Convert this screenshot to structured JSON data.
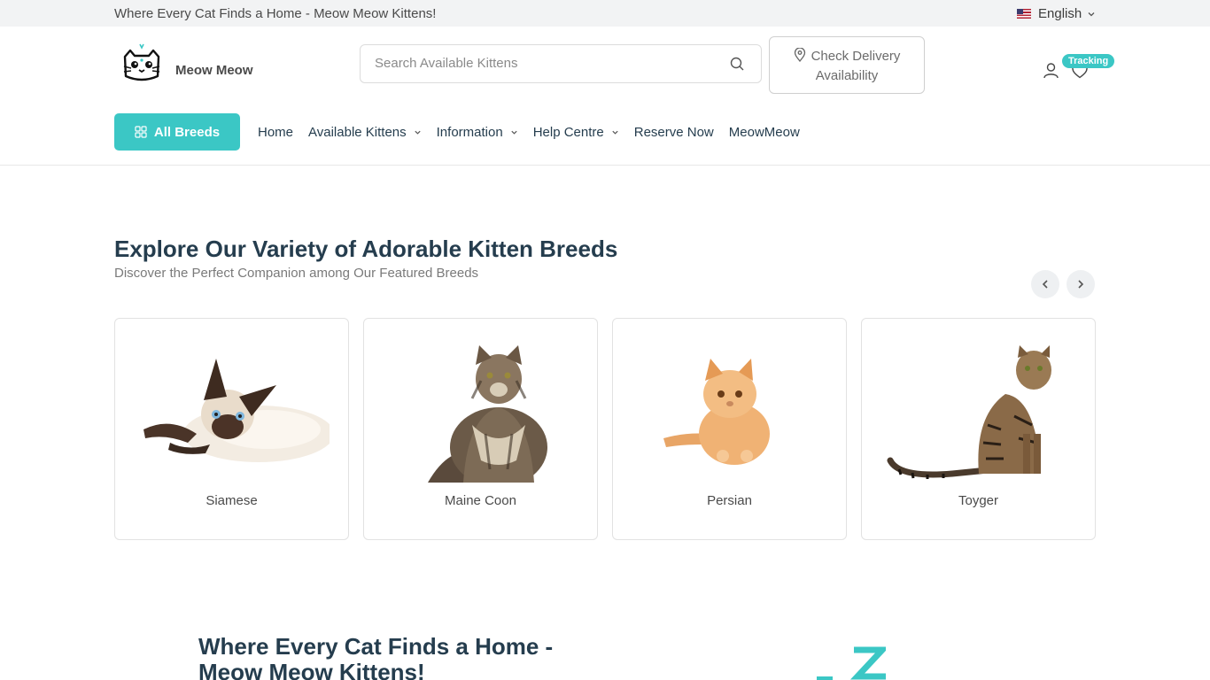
{
  "topbar": {
    "tagline": "Where Every Cat Finds a Home - Meow Meow Kittens!",
    "language": "English"
  },
  "header": {
    "brand": "Meow Meow",
    "search_placeholder": "Search Available Kittens",
    "delivery_line1": "Check Delivery",
    "delivery_line2": "Availability",
    "tracking_badge": "Tracking"
  },
  "nav": {
    "all_breeds": "All Breeds",
    "items": [
      {
        "label": "Home"
      },
      {
        "label": "Available Kittens"
      },
      {
        "label": "Information"
      },
      {
        "label": "Help Centre"
      },
      {
        "label": "Reserve Now"
      },
      {
        "label": "MeowMeow"
      }
    ]
  },
  "breeds_section": {
    "title": "Explore Our Variety of Adorable Kitten Breeds",
    "subtitle": "Discover the Perfect Companion among Our Featured Breeds",
    "cards": [
      {
        "name": "Siamese",
        "icon": "siamese-cat-image"
      },
      {
        "name": "Maine Coon",
        "icon": "maine-coon-cat-image"
      },
      {
        "name": "Persian",
        "icon": "persian-kitten-image"
      },
      {
        "name": "Toyger",
        "icon": "toyger-cat-image"
      }
    ]
  },
  "hero": {
    "title": "Where Every Cat Finds a Home - Meow Meow Kittens!"
  },
  "colors": {
    "accent": "#3bc7c5",
    "text_dark": "#253d4e",
    "topbar_bg": "#f2f3f4"
  }
}
